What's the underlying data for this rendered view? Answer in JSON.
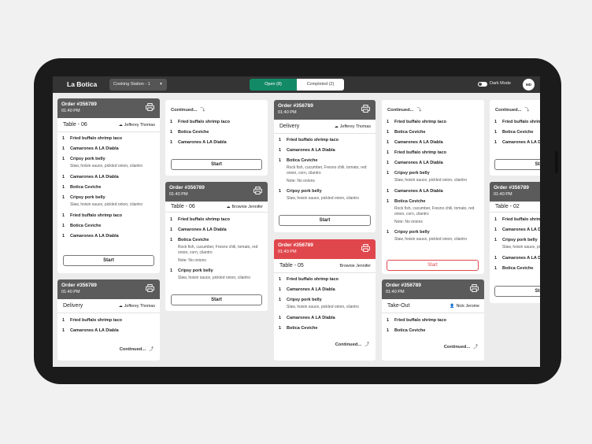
{
  "app": {
    "brand": "La Botica",
    "station": "Cooking Station - 1",
    "tab_open": "Open (8)",
    "tab_completed": "Completed (2)",
    "dark_mode_label": "Dark Mode",
    "avatar_initials": "MD",
    "accent": "#138a66",
    "urgent": "#e0474c"
  },
  "common": {
    "order_id": "Order #356789",
    "time": "01:40 PM",
    "start_label": "Start",
    "continued": "Continued..."
  },
  "items": {
    "fbst": "Fried buffalo shrimp taco",
    "cld": "Camarones A LA Diabla",
    "cpb": "Cripsy pork belly",
    "cpb_mods": "Slaw, hoisin sauce, pickled onion, cilantro",
    "bc": "Botica Ceviche",
    "bc_mods": "Rock fish, cucumber, Fresno chili, tomato, red onion, corn, cilantro",
    "note": "Note: No onions",
    "qty": "1"
  },
  "servers": {
    "jeff": "Jefferey Thomas",
    "brownie": "Brownie Jennifer",
    "nick": "Nick Jerome"
  },
  "places": {
    "t06": "Table - 06",
    "t05": "Table - 05",
    "t02": "Table - 02",
    "delivery": "Delivery",
    "takeout": "Take-Out"
  }
}
